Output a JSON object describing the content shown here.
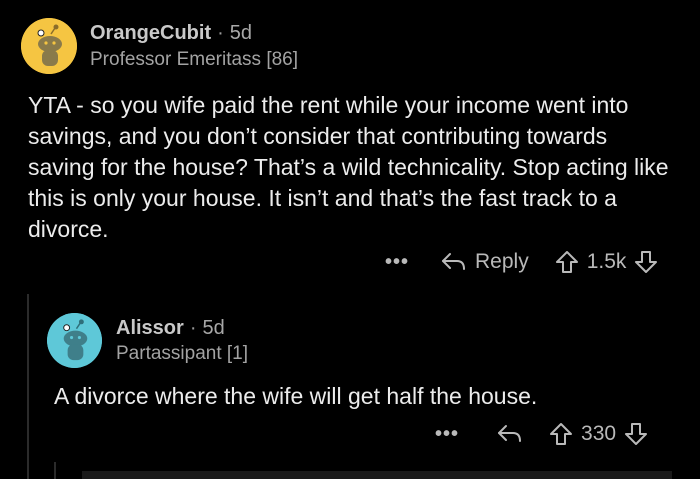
{
  "comment": {
    "author": "OrangeCubit",
    "separator": "·",
    "age": "5d",
    "flair": "Professor Emeritass [86]",
    "text": "YTA - so you wife paid the rent while your income went into savings, and you don’t consider that contributing towards saving for the house? That’s a wild technicality. Stop acting like this is only your house. It isn’t and that’s the fast track to a divorce.",
    "more": "•••",
    "reply_label": "Reply",
    "score": "1.5k",
    "avatar_color": "#f5c542"
  },
  "reply": {
    "author": "Alissor",
    "separator": "·",
    "age": "5d",
    "flair": "Partassipant [1]",
    "text": "A divorce where the wife will get half the house.",
    "more": "•••",
    "score": "330",
    "avatar_color": "#5ec8d8"
  },
  "icons": [
    "snoo-avatar-icon",
    "reply-arrow-icon",
    "upvote-icon",
    "downvote-icon",
    "more-options-icon"
  ]
}
